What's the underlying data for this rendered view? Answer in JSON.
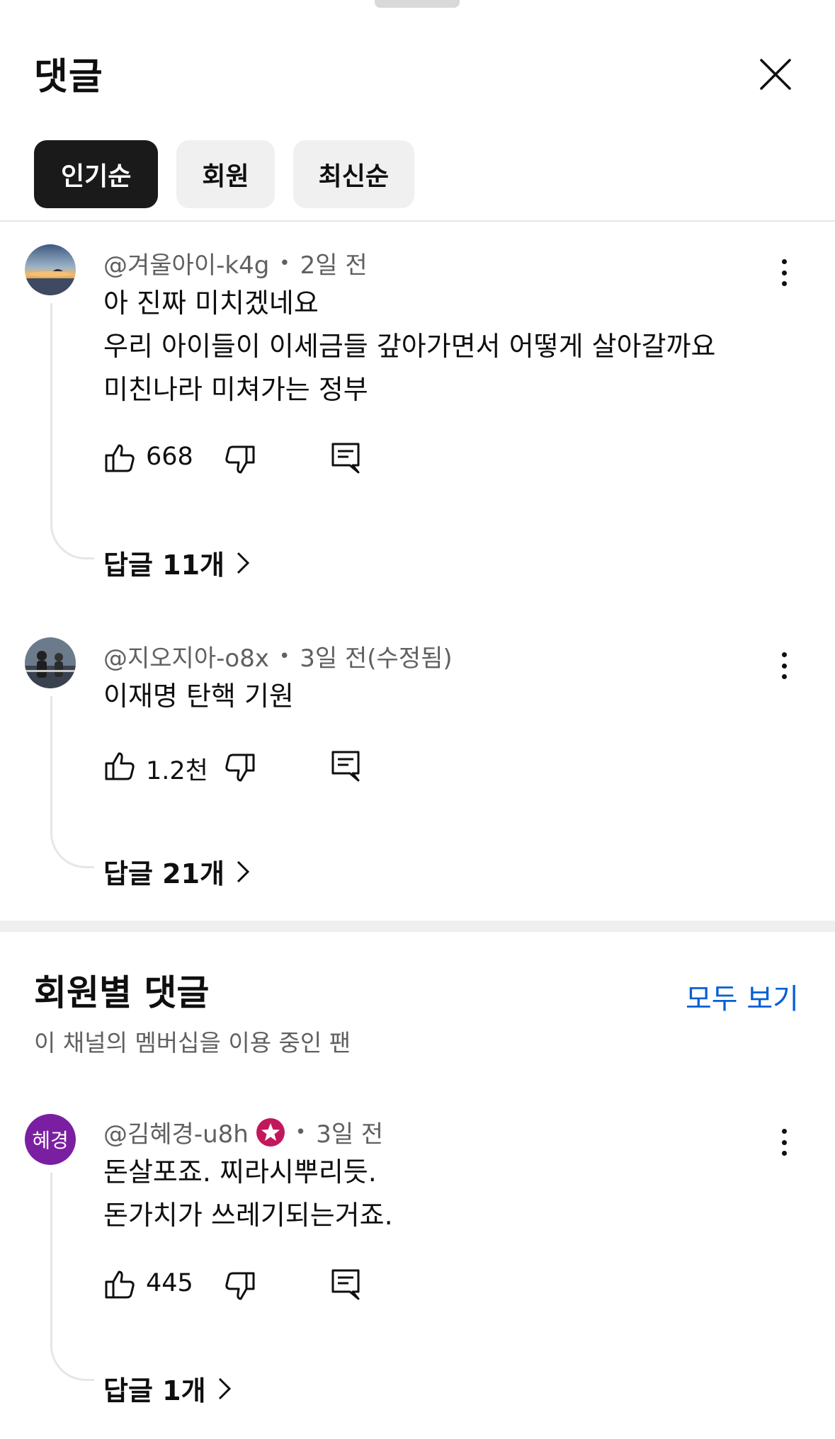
{
  "header": {
    "title": "댓글"
  },
  "filters": [
    {
      "label": "인기순",
      "active": true
    },
    {
      "label": "회원",
      "active": false
    },
    {
      "label": "최신순",
      "active": false
    }
  ],
  "comments": [
    {
      "author": "@겨울아이-k4g",
      "time": "2일 전",
      "lines": [
        "아 진짜 미치겠네요",
        "우리 아이들이 이세금들 갚아가면서 어떻게 살아갈까요",
        "미친나라 미쳐가는 정부"
      ],
      "likes": "668",
      "replies": "답글 11개"
    },
    {
      "author": "@지오지아-o8x",
      "time": "3일 전(수정됨)",
      "lines": [
        "이재명 탄핵 기원"
      ],
      "likes": "1.2천",
      "replies": "답글 21개"
    }
  ],
  "members_section": {
    "title": "회원별 댓글",
    "subtitle": "이 채널의 멤버십을 이용 중인 팬",
    "view_all": "모두 보기"
  },
  "member_comment": {
    "avatar_text": "혜경",
    "author": "@김혜경-u8h",
    "time": "3일 전",
    "lines": [
      "돈살포죠. 찌라시뿌리듯.",
      "돈가치가 쓰레기되는거죠."
    ],
    "likes": "445",
    "replies": "답글 1개"
  },
  "colors": {
    "accent": "#065fd4",
    "member_badge": "#c2185b",
    "letter_avatar": "#7b1fa2"
  },
  "icons": [
    "close-icon",
    "more-vert-icon",
    "thumb-up-icon",
    "thumb-down-icon",
    "reply-comment-icon",
    "chevron-right-icon",
    "member-star-icon"
  ]
}
